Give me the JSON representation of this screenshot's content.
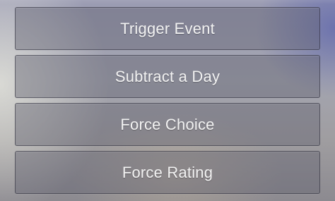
{
  "menu": {
    "buttons": [
      {
        "label": "Trigger Event"
      },
      {
        "label": "Subtract a Day"
      },
      {
        "label": "Force Choice"
      },
      {
        "label": "Force Rating"
      }
    ]
  }
}
